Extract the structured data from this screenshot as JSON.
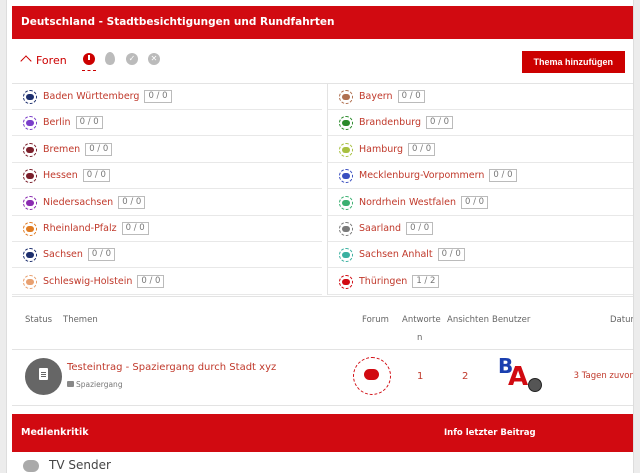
{
  "header": {
    "title": "Deutschland - Stadtbesichtigungen und Rundfahrten"
  },
  "toolbar": {
    "foren_label": "Foren",
    "icons": [
      "clock-icon",
      "flame-icon",
      "check-icon",
      "x-icon"
    ],
    "add_button": "Thema hinzufügen"
  },
  "forums_left": [
    {
      "name": "Baden Württemberg",
      "count": "0 / 0",
      "color": "#1d2f6e"
    },
    {
      "name": "Berlin",
      "count": "0 / 0",
      "color": "#7a3ec9"
    },
    {
      "name": "Bremen",
      "count": "0 / 0",
      "color": "#7a1f2b"
    },
    {
      "name": "Hessen",
      "count": "0 / 0",
      "color": "#7a1f2b"
    },
    {
      "name": "Niedersachsen",
      "count": "0 / 0",
      "color": "#8a2bb0"
    },
    {
      "name": "Rheinland-Pfalz",
      "count": "0 / 0",
      "color": "#e07b22"
    },
    {
      "name": "Sachsen",
      "count": "0 / 0",
      "color": "#1d2f6e"
    },
    {
      "name": "Schleswig-Holstein",
      "count": "0 / 0",
      "color": "#e8a070"
    }
  ],
  "forums_right": [
    {
      "name": "Bayern",
      "count": "0 / 0",
      "color": "#b07050"
    },
    {
      "name": "Brandenburg",
      "count": "0 / 0",
      "color": "#2a8a2a"
    },
    {
      "name": "Hamburg",
      "count": "0 / 0",
      "color": "#a8c040"
    },
    {
      "name": "Mecklenburg-Vorpommern",
      "count": "0 / 0",
      "color": "#3a4fc0"
    },
    {
      "name": "Nordrhein Westfalen",
      "count": "0 / 0",
      "color": "#3ab070"
    },
    {
      "name": "Saarland",
      "count": "0 / 0",
      "color": "#7a7a7a"
    },
    {
      "name": "Sachsen Anhalt",
      "count": "0 / 0",
      "color": "#3ab0a0"
    },
    {
      "name": "Thüringen",
      "count": "1 / 2",
      "color": "#d10a11"
    }
  ],
  "table_header": {
    "status": "Status",
    "themen": "Themen",
    "forum": "Forum",
    "antworten_1": "Antworte",
    "antworten_2": "n",
    "ansichten": "Ansichten",
    "benutzer": "Benutzer",
    "datum": "Datum"
  },
  "topic": {
    "title": "Testeintrag - Spaziergang durch Stadt xyz",
    "tag": "Spaziergang",
    "answers": "1",
    "views": "2",
    "date": "3 Tagen zuvor"
  },
  "section2": {
    "title": "Medienkritik",
    "info": "Info letzter Beitrag"
  },
  "subforum": {
    "name": "TV Sender"
  },
  "colors": {
    "accent": "#d10a11"
  }
}
